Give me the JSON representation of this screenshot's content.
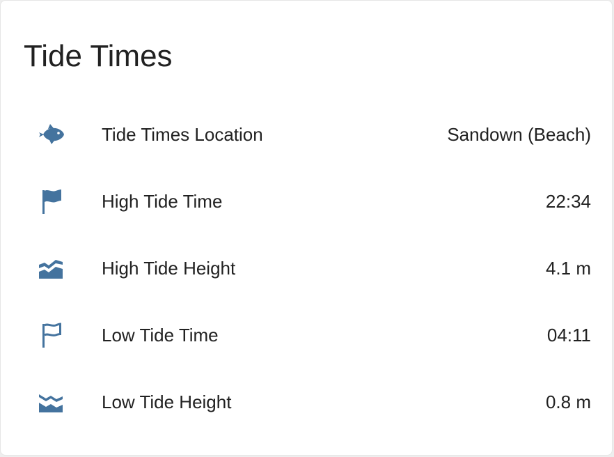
{
  "card": {
    "title": "Tide Times",
    "icon_color": "#44739e",
    "rows": [
      {
        "icon": "fish-icon",
        "label": "Tide Times Location",
        "value": "Sandown (Beach)"
      },
      {
        "icon": "flag-icon",
        "label": "High Tide Time",
        "value": "22:34"
      },
      {
        "icon": "wave-rising-icon",
        "label": "High Tide Height",
        "value": "4.1 m"
      },
      {
        "icon": "flag-outline-icon",
        "label": "Low Tide Time",
        "value": "04:11"
      },
      {
        "icon": "wave-falling-icon",
        "label": "Low Tide Height",
        "value": "0.8 m"
      }
    ]
  }
}
